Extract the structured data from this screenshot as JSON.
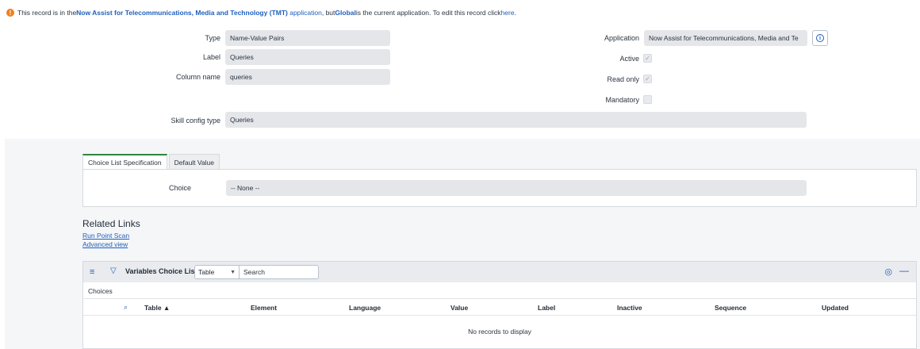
{
  "banner": {
    "icon": "warning-icon",
    "text_prefix": "This record is in the ",
    "app_name": "Now Assist for Telecommunications, Media and Technology (TMT)",
    "app_word": "application",
    "text_mid": ", but ",
    "global": "Global",
    "text_suffix": " is the current application. To edit this record click ",
    "here": "here",
    "period": "."
  },
  "form": {
    "type_label": "Type",
    "type_value": "Name-Value Pairs",
    "label_label": "Label",
    "label_value": "Queries",
    "column_label": "Column name",
    "column_value": "queries",
    "skill_label": "Skill config type",
    "skill_value": "Queries",
    "application_label": "Application",
    "application_value": "Now Assist for Telecommunications, Media and Te",
    "active_label": "Active",
    "active_checked": true,
    "readonly_label": "Read only",
    "readonly_checked": true,
    "mandatory_label": "Mandatory",
    "mandatory_checked": false,
    "check_glyph": "✓"
  },
  "tabs": [
    {
      "label": "Choice List Specification",
      "active": true
    },
    {
      "label": "Default Value",
      "active": false
    }
  ],
  "choice": {
    "label": "Choice",
    "value": "-- None --"
  },
  "related": {
    "title": "Related Links",
    "links": [
      "Run Point Scan",
      "Advanced view"
    ]
  },
  "list": {
    "title": "Variables Choice List",
    "select_value": "Table",
    "search_placeholder": "Search",
    "subheading": "Choices",
    "columns": [
      "Table ▲",
      "Element",
      "Language",
      "Value",
      "Label",
      "Inactive",
      "Sequence",
      "Updated"
    ],
    "empty_text": "No records to display"
  },
  "colors": {
    "accent": "#1f5fbf",
    "tab_active": "#2e8540",
    "warning": "#f0801a"
  }
}
